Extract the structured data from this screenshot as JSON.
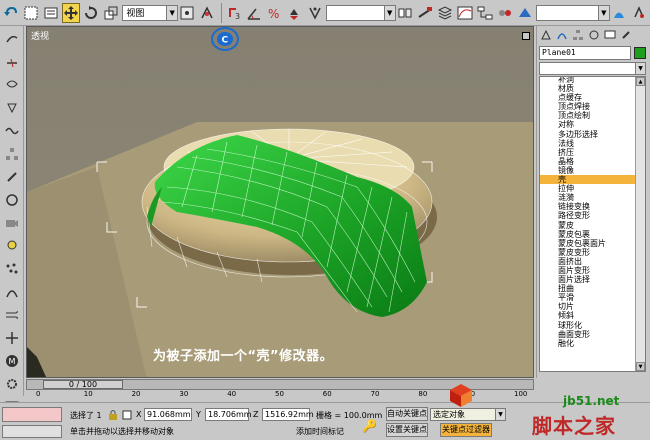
{
  "toolbar": {
    "view_combo": "视图",
    "selection_set_combo": "",
    "render_combo": ""
  },
  "viewport": {
    "label": "透视",
    "caption": "为被子添加一个“壳”修改器。",
    "badge": "C"
  },
  "command_panel": {
    "object_name": "Plane01",
    "object_color": "#1ea01e",
    "modifier_list_value": "",
    "modifiers": [
      "补洞",
      "材质",
      "点缓存",
      "顶点焊接",
      "顶点绘制",
      "对称",
      "多边形选择",
      "法线",
      "挤压",
      "晶格",
      "镜像",
      "壳",
      "拉伸",
      "涟漪",
      "链接变换",
      "路径变形",
      "蒙皮",
      "蒙皮包裹",
      "蒙皮包裹面片",
      "蒙皮变形",
      "面挤出",
      "面片变形",
      "面片选择",
      "扭曲",
      "平滑",
      "切片",
      "倾斜",
      "球形化",
      "曲面变形",
      "融化"
    ],
    "selected_modifier": "壳"
  },
  "timeline": {
    "frame_display": "0 / 100",
    "ticks": [
      "0",
      "10",
      "20",
      "30",
      "40",
      "50",
      "60",
      "70",
      "80",
      "90",
      "100"
    ]
  },
  "status": {
    "selected_count": "选择了 1",
    "x_label": "X",
    "x_value": "91.068mm",
    "y_label": "Y",
    "y_value": "18.706mm",
    "z_label": "Z",
    "z_value": "1516.92mm",
    "grid": "栅格 = 100.0mm",
    "auto_key": "自动关键点",
    "selected_object": "选定对象",
    "set_key": "设置关键点",
    "key_filters": "关键点过滤器",
    "prompt": "单击并拖动以选择并移动对象",
    "add_time_tag": "添加时间标记"
  },
  "watermark": {
    "site": "jb51.net",
    "name": "脚本之家"
  }
}
